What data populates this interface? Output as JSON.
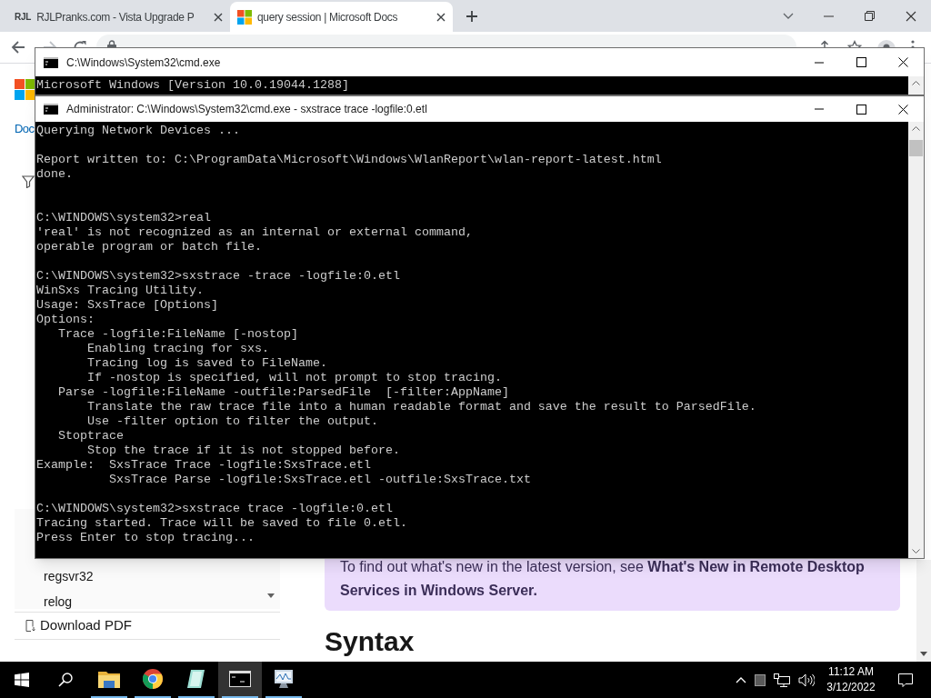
{
  "browser": {
    "tabs": [
      {
        "favicon_text": "RJL",
        "title": "RJLPranks.com - Vista Upgrade P",
        "selected": false
      },
      {
        "title": "query session | Microsoft Docs",
        "selected": true
      }
    ]
  },
  "page": {
    "sidebar_title": "Doc",
    "sidebar_items": [
      {
        "label": "regsvr32"
      },
      {
        "label": "relog"
      }
    ],
    "download_label": "Download PDF",
    "note": "To find out what's new in the latest version, see **What's New in Remote Desktop Services in Windows Server.**",
    "heading": "Syntax"
  },
  "console_windows": [
    {
      "title": "C:\\Windows\\System32\\cmd.exe",
      "blocks": [
        {
          "kind": "last",
          "lines": [
            "Microsoft Windows [Version 10.0.19044.1288]"
          ]
        }
      ]
    },
    {
      "title": "Administrator: C:\\Windows\\System32\\cmd.exe - sxstrace  trace -logfile:0.etl",
      "blocks": [
        {
          "kind": "spaced",
          "lines": [
            "Querying Network Devices ..."
          ]
        },
        {
          "kind": "double_spaced",
          "lines": [
            "Report written to: C:\\ProgramData\\Microsoft\\Windows\\WlanReport\\wlan-report-latest.html",
            "done."
          ]
        },
        {
          "kind": "spaced",
          "lines": [
            "C:\\WINDOWS\\system32>real",
            "'real' is not recognized as an internal or external command,",
            "operable program or batch file."
          ]
        },
        {
          "kind": "spaced",
          "lines": [
            "C:\\WINDOWS\\system32>sxstrace -trace -logfile:0.etl",
            "WinSxs Tracing Utility.",
            "Usage: SxsTrace [Options]",
            "Options:",
            "   Trace -logfile:FileName [-nostop]",
            "       Enabling tracing for sxs.",
            "       Tracing log is saved to FileName.",
            "       If -nostop is specified, will not prompt to stop tracing.",
            "   Parse -logfile:FileName -outfile:ParsedFile  [-filter:AppName]",
            "       Translate the raw trace file into a human readable format and save the result to ParsedFile.",
            "       Use -filter option to filter the output.",
            "   Stoptrace",
            "       Stop the trace if it is not stopped before.",
            "Example:  SxsTrace Trace -logfile:SxsTrace.etl",
            "          SxsTrace Parse -logfile:SxsTrace.etl -outfile:SxsTrace.txt"
          ]
        },
        {
          "kind": "last",
          "lines": [
            "C:\\WINDOWS\\system32>sxstrace trace -logfile:0.etl",
            "Tracing started. Trace will be saved to file 0.etl.",
            "Press Enter to stop tracing..."
          ]
        }
      ]
    }
  ],
  "taskbar": {
    "apps": [
      {
        "kind": "folder",
        "running": true,
        "selected": false
      },
      {
        "kind": "chrome",
        "running": true,
        "selected": false
      },
      {
        "kind": "notepad",
        "running": true,
        "selected": false
      },
      {
        "kind": "console",
        "running": true,
        "selected": true
      },
      {
        "kind": "monitor",
        "running": true,
        "selected": false
      }
    ],
    "time": "11:12 AM",
    "date": "3/12/2022"
  }
}
